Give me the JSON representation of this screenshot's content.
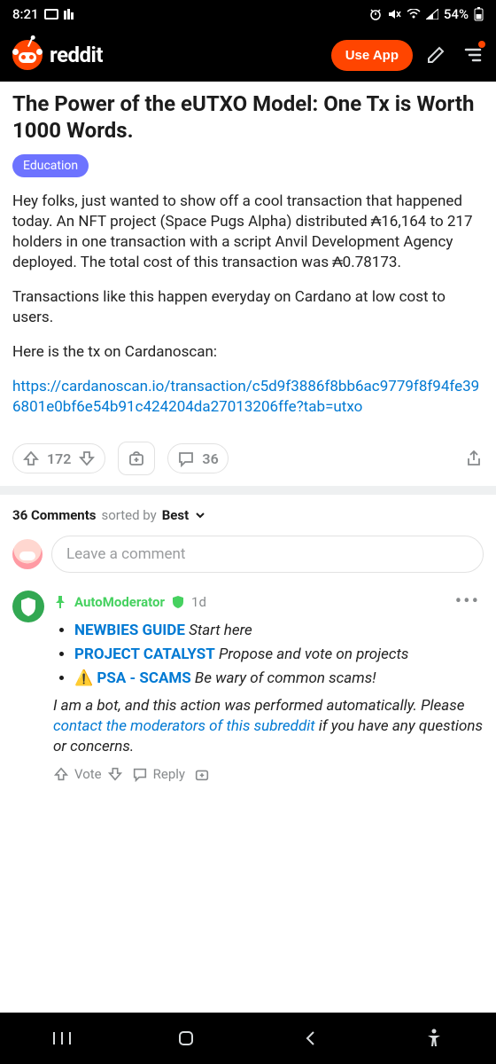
{
  "statusbar": {
    "time": "8:21",
    "battery": "54%"
  },
  "header": {
    "brand": "reddit",
    "useapp": "Use App"
  },
  "post": {
    "title": "The Power of the eUTXO Model: One Tx is Worth 1000 Words.",
    "flair": "Education",
    "para1": "Hey folks, just wanted to show off a cool transaction that happened today. An NFT project (Space Pugs Alpha) distributed ₳16,164 to 217 holders in one transaction with a script Anvil Development Agency deployed. The total cost of this transaction was ₳0.78173.",
    "para2": "Transactions like this happen everyday on Cardano at low cost to users.",
    "para3": "Here is the tx on Cardanoscan:",
    "link": "https://cardanoscan.io/transaction/c5d9f3886f8bb6ac9779f8f94fe396801e0bf6e54b91c424204da27013206ffe?tab=utxo"
  },
  "actions": {
    "score": "172",
    "comments": "36"
  },
  "commentsHeader": {
    "count": "36 Comments",
    "sorted": "sorted by",
    "sort": "Best"
  },
  "addComment": {
    "placeholder": "Leave a comment"
  },
  "autoMod": {
    "author": "AutoModerator",
    "age": "1d",
    "items": [
      {
        "warn": "",
        "link": "NEWBIES GUIDE",
        "rest": " Start here"
      },
      {
        "warn": "",
        "link": "PROJECT CATALYST",
        "rest": " Propose and vote on projects"
      },
      {
        "warn": "⚠️ ",
        "link": "PSA - SCAMS",
        "rest": " Be wary of common scams!"
      }
    ],
    "sign1": "I am a bot, and this action was performed automatically. Please ",
    "signLink": "contact the moderators of this subreddit",
    "sign2": " if you have any questions or concerns."
  },
  "cactions": {
    "vote": "Vote",
    "reply": "Reply"
  }
}
